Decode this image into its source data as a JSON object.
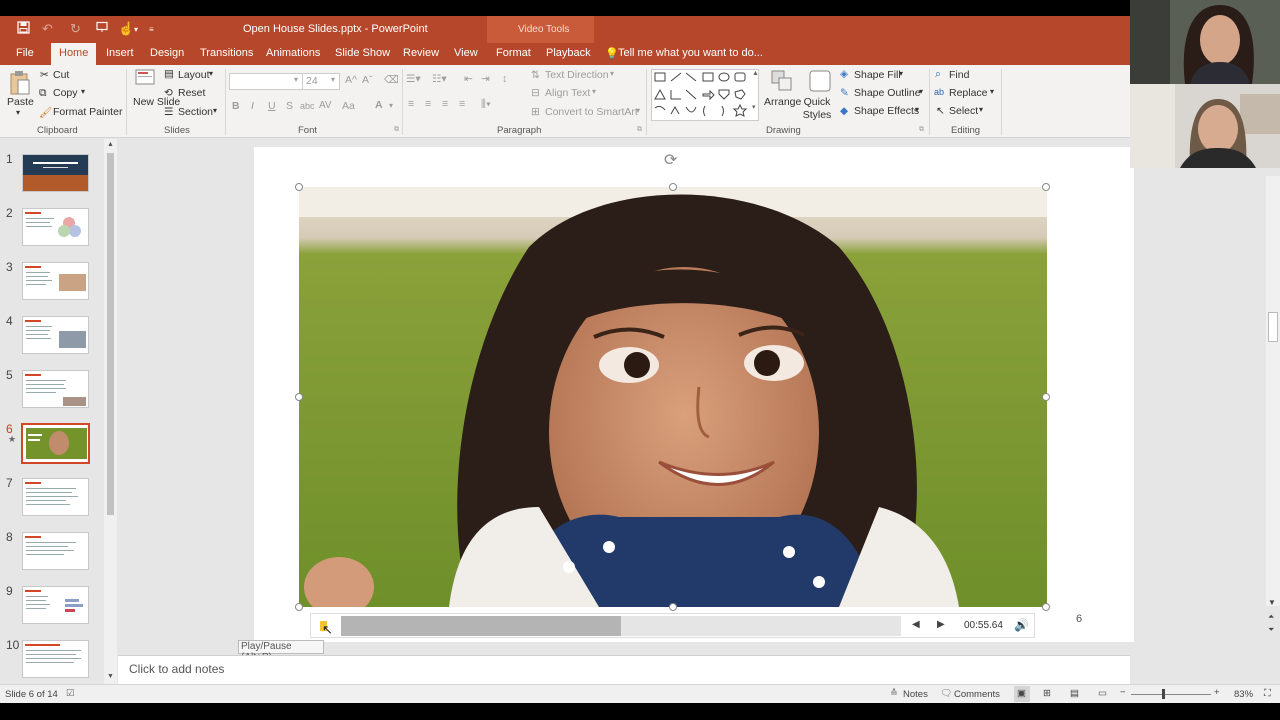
{
  "titlebar": {
    "title": "Open House Slides.pptx - PowerPoint",
    "context_label": "Video Tools"
  },
  "tabs": [
    "File",
    "Home",
    "Insert",
    "Design",
    "Transitions",
    "Animations",
    "Slide Show",
    "Review",
    "View",
    "Format",
    "Playback"
  ],
  "tell_me": "Tell me what you want to do...",
  "ribbon": {
    "clipboard": {
      "paste": "Paste",
      "cut": "Cut",
      "copy": "Copy",
      "format_painter": "Format Painter",
      "label": "Clipboard"
    },
    "slides": {
      "new_slide": "New Slide",
      "layout": "Layout",
      "reset": "Reset",
      "section": "Section",
      "label": "Slides"
    },
    "font": {
      "font_size": "24",
      "bold": "B",
      "italic": "I",
      "underline": "U",
      "strike": "S",
      "shadow": "abc",
      "spacing": "AV",
      "color": "A",
      "aa": "Aa",
      "label": "Font"
    },
    "paragraph": {
      "text_direction": "Text Direction",
      "align_text": "Align Text",
      "convert_smartart": "Convert to SmartArt",
      "label": "Paragraph"
    },
    "drawing": {
      "arrange": "Arrange",
      "quick_styles": "Quick Styles",
      "shape_fill": "Shape Fill",
      "shape_outline": "Shape Outline",
      "shape_effects": "Shape Effects",
      "label": "Drawing"
    },
    "editing": {
      "find": "Find",
      "replace": "Replace",
      "select": "Select",
      "label": "Editing"
    }
  },
  "slides": [
    {
      "num": "1"
    },
    {
      "num": "2"
    },
    {
      "num": "3"
    },
    {
      "num": "4"
    },
    {
      "num": "5"
    },
    {
      "num": "6",
      "active": true,
      "star": "★"
    },
    {
      "num": "7"
    },
    {
      "num": "8"
    },
    {
      "num": "9"
    },
    {
      "num": "10"
    }
  ],
  "video": {
    "time": "00:55.64",
    "progress": 0.5,
    "tooltip": "Play/Pause (Alt+P)"
  },
  "slide_page_number": "6",
  "notes_placeholder": "Click to add notes",
  "status": {
    "slide_info": "Slide 6 of 14",
    "notes": "Notes",
    "comments": "Comments",
    "zoom": "83%"
  },
  "colors": {
    "accent": "#b7472a",
    "active_thumb": "#d24726"
  }
}
